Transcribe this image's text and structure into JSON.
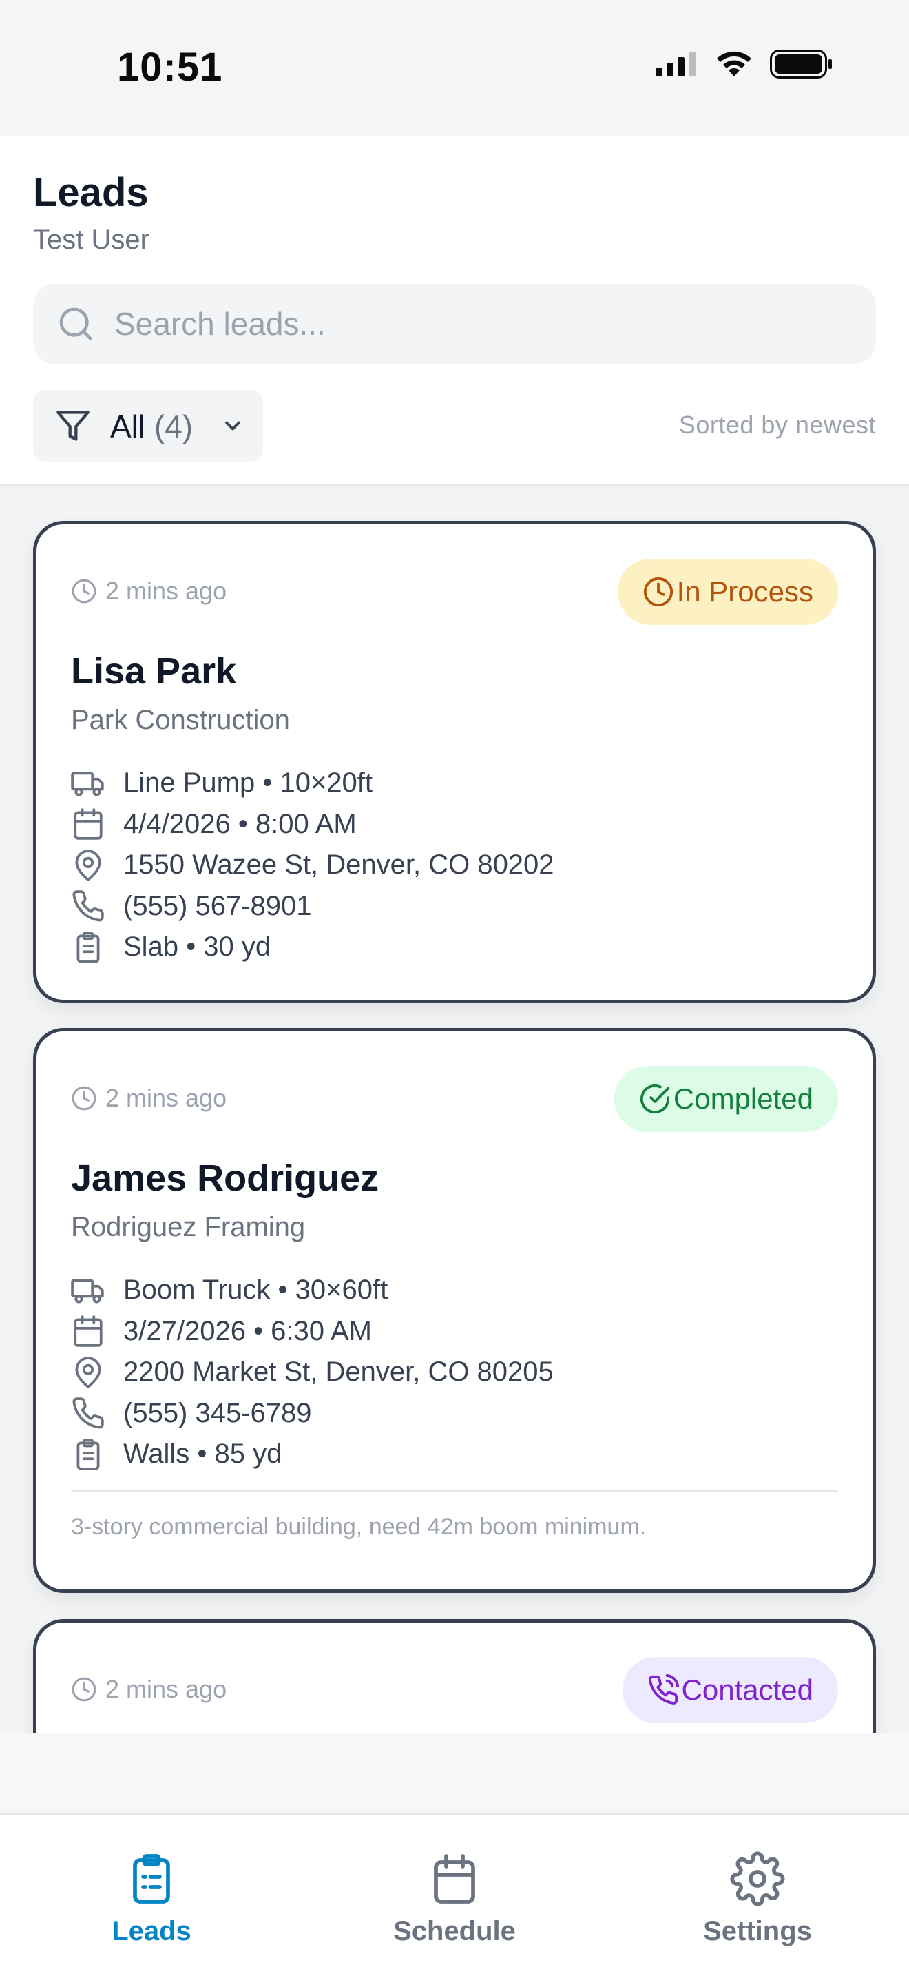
{
  "status_bar": {
    "time": "10:51"
  },
  "header": {
    "title": "Leads",
    "subtitle": "Test User",
    "search_placeholder": "Search leads...",
    "filter_label": "All",
    "filter_count": "(4)",
    "sort_text": "Sorted by newest"
  },
  "leads": [
    {
      "time": "2 mins ago",
      "status": "In Process",
      "name": "Lisa Park",
      "company": "Park Construction",
      "equipment": "Line Pump • 10×20ft",
      "datetime": "4/4/2026 • 8:00 AM",
      "address": "1550 Wazee St, Denver, CO 80202",
      "phone": "(555) 567-8901",
      "job": "Slab • 30 yd"
    },
    {
      "time": "2 mins ago",
      "status": "Completed",
      "name": "James Rodriguez",
      "company": "Rodriguez Framing",
      "equipment": "Boom Truck • 30×60ft",
      "datetime": "3/27/2026 • 6:30 AM",
      "address": "2200 Market St, Denver, CO 80205",
      "phone": "(555) 345-6789",
      "job": "Walls • 85 yd",
      "note": "3-story commercial building, need 42m boom minimum."
    },
    {
      "time": "2 mins ago",
      "status": "Contacted"
    }
  ],
  "tabs": [
    {
      "label": "Leads",
      "icon": "clipboard-icon",
      "active": true
    },
    {
      "label": "Schedule",
      "icon": "calendar-icon",
      "active": false
    },
    {
      "label": "Settings",
      "icon": "gear-icon",
      "active": false
    }
  ],
  "colors": {
    "accent": "#0284c7",
    "in_process": "#b4540a",
    "completed": "#15803d",
    "contacted": "#7e22ce"
  }
}
